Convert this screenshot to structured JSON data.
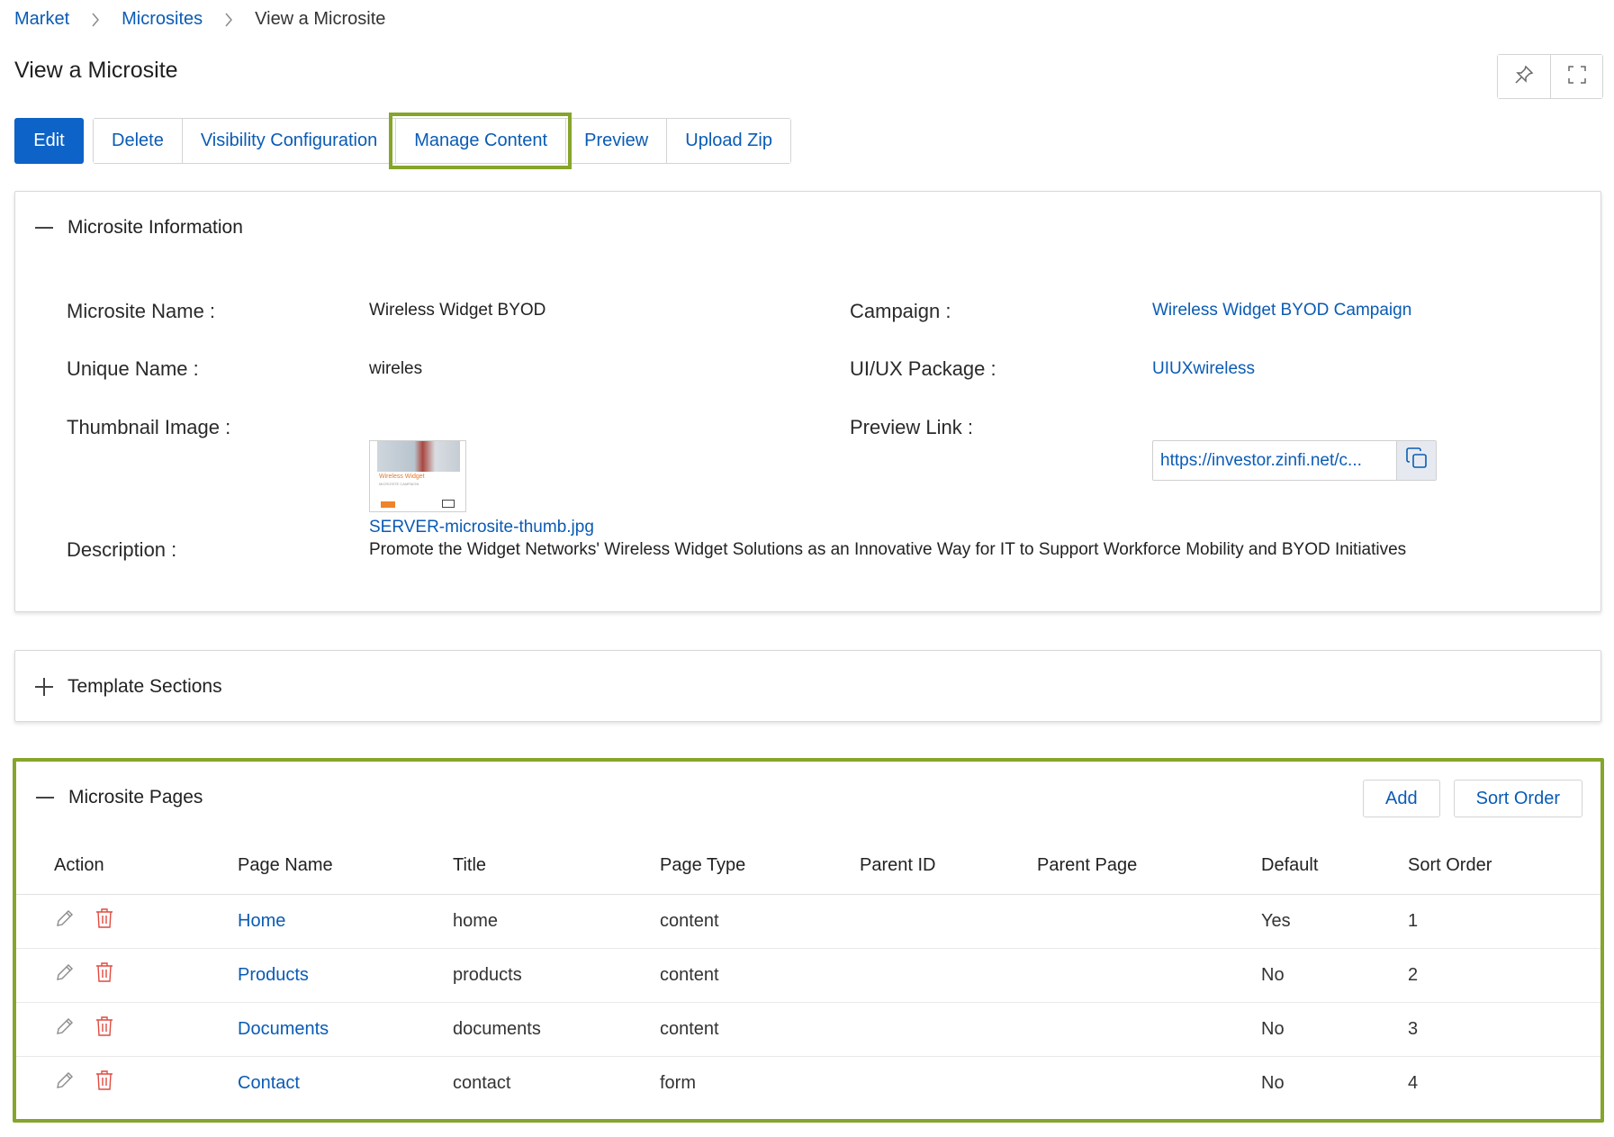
{
  "breadcrumb": {
    "items": [
      "Market",
      "Microsites"
    ],
    "current": "View a Microsite"
  },
  "page_title": "View a Microsite",
  "toolbar": {
    "edit": "Edit",
    "delete": "Delete",
    "visibility": "Visibility Configuration",
    "manage_content": "Manage Content",
    "preview": "Preview",
    "upload_zip": "Upload Zip"
  },
  "info": {
    "header": "Microsite Information",
    "microsite_name_label": "Microsite Name :",
    "microsite_name_value": "Wireless Widget BYOD",
    "unique_name_label": "Unique Name :",
    "unique_name_value": "wireles",
    "thumbnail_label": "Thumbnail Image :",
    "thumbnail_file": "SERVER-microsite-thumb.jpg",
    "thumbnail_caption": "Wireless Widget",
    "thumbnail_subcaption": "MICROSITE CAMPAIGN",
    "description_label": "Description :",
    "description_value": "Promote the Widget Networks' Wireless Widget Solutions as an Innovative Way for IT to Support Workforce Mobility and BYOD Initiatives",
    "campaign_label": "Campaign :",
    "campaign_value": "Wireless Widget BYOD Campaign",
    "uiux_label": "UI/UX Package :",
    "uiux_value": "UIUXwireless",
    "preview_label": "Preview Link :",
    "preview_value": "https://investor.zinfi.net/c..."
  },
  "template_sections": {
    "header": "Template Sections"
  },
  "pages": {
    "header": "Microsite Pages",
    "add": "Add",
    "sort_order": "Sort Order",
    "columns": [
      "Action",
      "Page Name",
      "Title",
      "Page Type",
      "Parent ID",
      "Parent Page",
      "Default",
      "Sort Order"
    ],
    "rows": [
      {
        "page_name": "Home",
        "title": "home",
        "page_type": "content",
        "parent_id": "",
        "parent_page": "",
        "default": "Yes",
        "sort_order": "1"
      },
      {
        "page_name": "Products",
        "title": "products",
        "page_type": "content",
        "parent_id": "",
        "parent_page": "",
        "default": "No",
        "sort_order": "2"
      },
      {
        "page_name": "Documents",
        "title": "documents",
        "page_type": "content",
        "parent_id": "",
        "parent_page": "",
        "default": "No",
        "sort_order": "3"
      },
      {
        "page_name": "Contact",
        "title": "contact",
        "page_type": "form",
        "parent_id": "",
        "parent_page": "",
        "default": "No",
        "sort_order": "4"
      }
    ]
  },
  "colors": {
    "accent": "#0d63c7",
    "link": "#0a5bb5",
    "highlight": "#86a52b",
    "delete_icon": "#e04a3f"
  },
  "icons": {
    "breadcrumb_separator": "chevron-right-icon",
    "pin": "pin-icon",
    "fullscreen": "fullscreen-icon",
    "collapse": "minus-icon",
    "expand": "plus-icon",
    "copy": "copy-icon",
    "edit": "pencil-icon",
    "delete": "trash-icon"
  }
}
